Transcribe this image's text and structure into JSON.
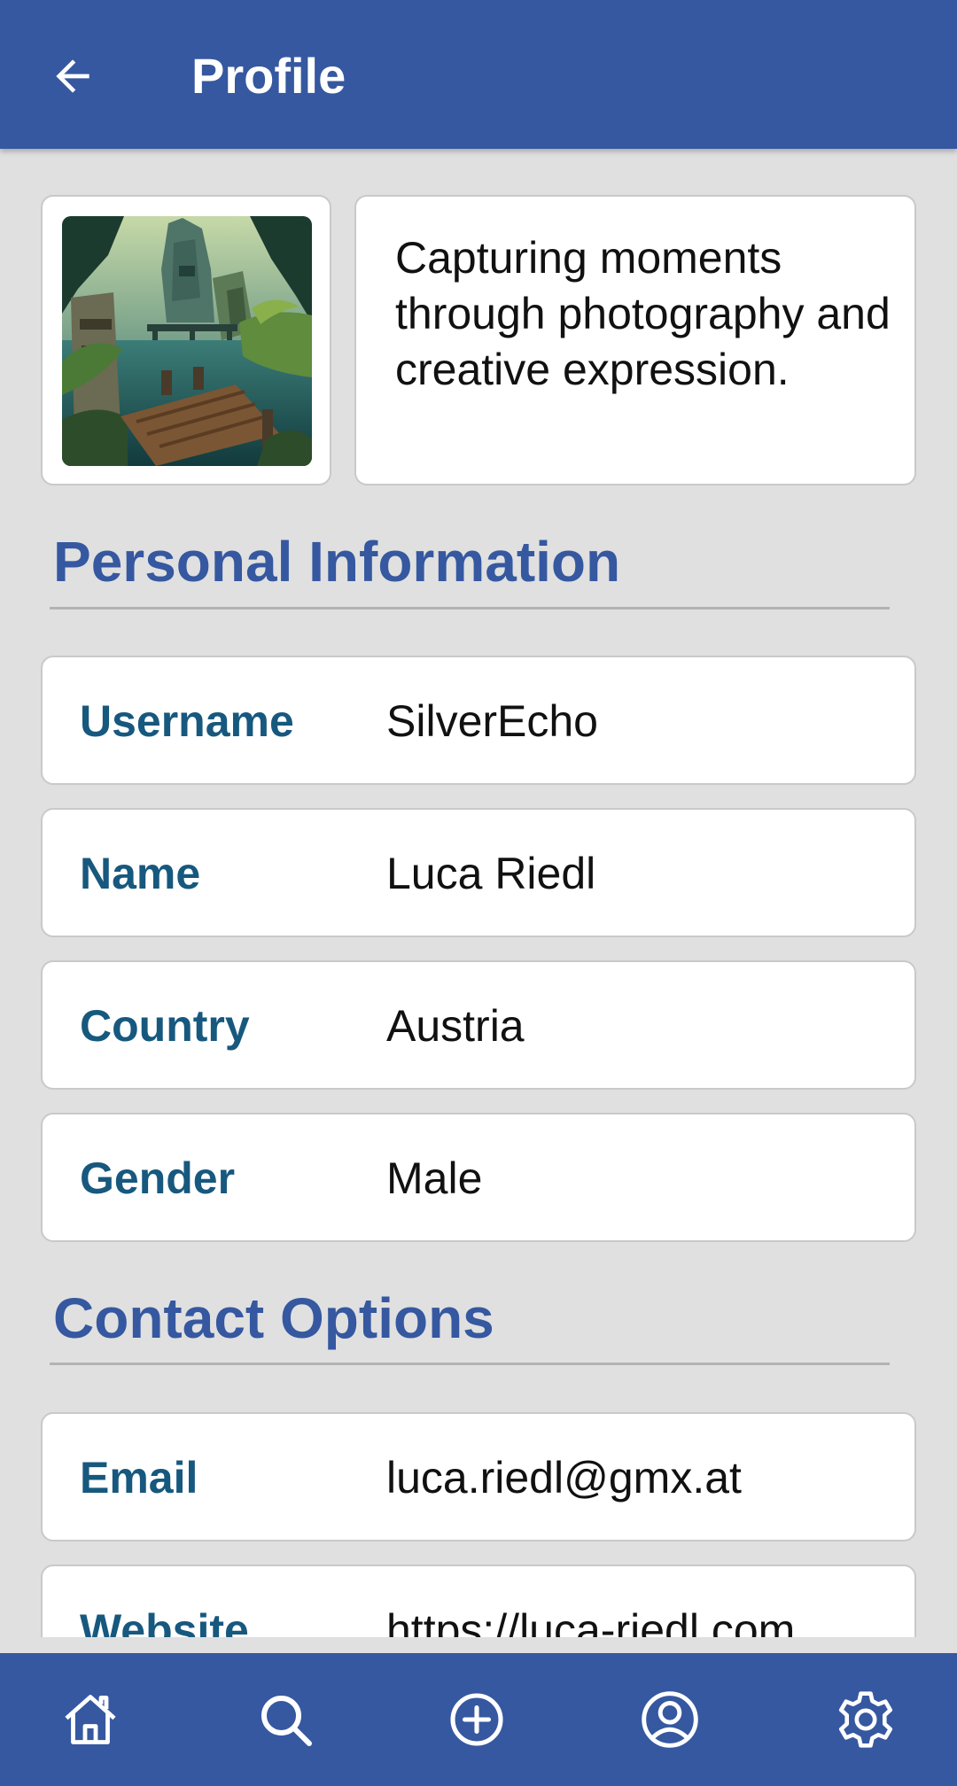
{
  "header": {
    "title": "Profile",
    "back_icon": "arrow-left-icon"
  },
  "profile": {
    "avatar_icon": "jungle-temple-landscape-image",
    "bio": "Capturing moments through photography and creative expression."
  },
  "personal_information": {
    "title": "Personal Information",
    "rows": [
      {
        "label": "Username",
        "value": "SilverEcho"
      },
      {
        "label": "Name",
        "value": "Luca Riedl"
      },
      {
        "label": "Country",
        "value": "Austria"
      },
      {
        "label": "Gender",
        "value": "Male"
      }
    ]
  },
  "contact_options": {
    "title": "Contact Options",
    "rows": [
      {
        "label": "Email",
        "value": "luca.riedl@gmx.at"
      },
      {
        "label": "Website",
        "value": "https://luca-riedl.com"
      }
    ]
  },
  "bottom_nav": {
    "items": [
      {
        "icon": "home-icon"
      },
      {
        "icon": "search-icon"
      },
      {
        "icon": "add-circle-icon"
      },
      {
        "icon": "profile-icon"
      },
      {
        "icon": "settings-icon"
      }
    ]
  },
  "colors": {
    "primary": "#3558a0",
    "label": "#17587e",
    "background": "#e0e0e0",
    "card": "#ffffff"
  }
}
